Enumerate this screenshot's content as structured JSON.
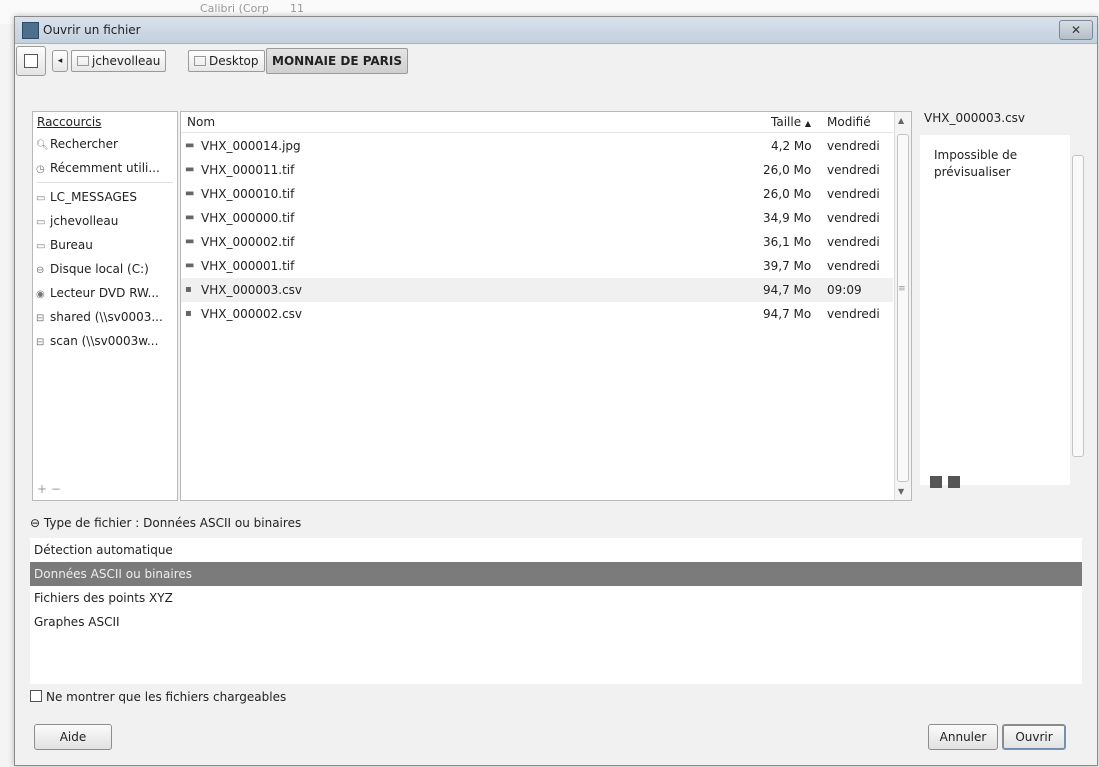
{
  "background_app": {
    "font_name": "Calibri (Corp",
    "font_size": "11"
  },
  "window": {
    "title": "Ouvrir un fichier",
    "close_label": "✕"
  },
  "pathbar": {
    "crumbs": [
      "jchevolleau",
      "Desktop",
      "MONNAIE DE PARIS"
    ]
  },
  "places": {
    "header": "Raccourcis",
    "items": [
      {
        "label": "Rechercher",
        "icon": "search-icon"
      },
      {
        "label": "Récemment utili...",
        "icon": "recent-icon"
      },
      {
        "label": "LC_MESSAGES",
        "icon": "folder-icon"
      },
      {
        "label": "jchevolleau",
        "icon": "folder-icon"
      },
      {
        "label": "Bureau",
        "icon": "folder-icon"
      },
      {
        "label": "Disque local (C:)",
        "icon": "drive-icon"
      },
      {
        "label": "Lecteur DVD RW...",
        "icon": "dvd-icon"
      },
      {
        "label": "shared (\\\\sv0003...",
        "icon": "network-drive-icon"
      },
      {
        "label": "scan (\\\\sv0003w...",
        "icon": "network-drive-icon"
      }
    ],
    "add_remove": "+ −"
  },
  "files": {
    "columns": {
      "name": "Nom",
      "size": "Taille",
      "modified": "Modifié"
    },
    "rows": [
      {
        "name": "VHX_000014.jpg",
        "size": "4,2 Mo",
        "modified": "vendredi"
      },
      {
        "name": "VHX_000011.tif",
        "size": "26,0 Mo",
        "modified": "vendredi"
      },
      {
        "name": "VHX_000010.tif",
        "size": "26,0 Mo",
        "modified": "vendredi"
      },
      {
        "name": "VHX_000000.tif",
        "size": "34,9 Mo",
        "modified": "vendredi"
      },
      {
        "name": "VHX_000002.tif",
        "size": "36,1 Mo",
        "modified": "vendredi"
      },
      {
        "name": "VHX_000001.tif",
        "size": "39,7 Mo",
        "modified": "vendredi"
      },
      {
        "name": "VHX_000003.csv",
        "size": "94,7 Mo",
        "modified": "09:09",
        "selected": true
      },
      {
        "name": "VHX_000002.csv",
        "size": "94,7 Mo",
        "modified": "vendredi"
      }
    ]
  },
  "preview": {
    "filename": "VHX_000003.csv",
    "message": "Impossible de prévisualiser"
  },
  "filetype": {
    "label": "Type de fichier : Données ASCII ou binaires",
    "options": [
      {
        "label": "Détection automatique"
      },
      {
        "label": "Données ASCII ou binaires",
        "selected": true
      },
      {
        "label": "Fichiers des points XYZ"
      },
      {
        "label": "Graphes ASCII"
      }
    ]
  },
  "checkbox": {
    "label": "Ne montrer que les fichiers chargeables"
  },
  "buttons": {
    "help": "Aide",
    "cancel": "Annuler",
    "open": "Ouvrir"
  }
}
